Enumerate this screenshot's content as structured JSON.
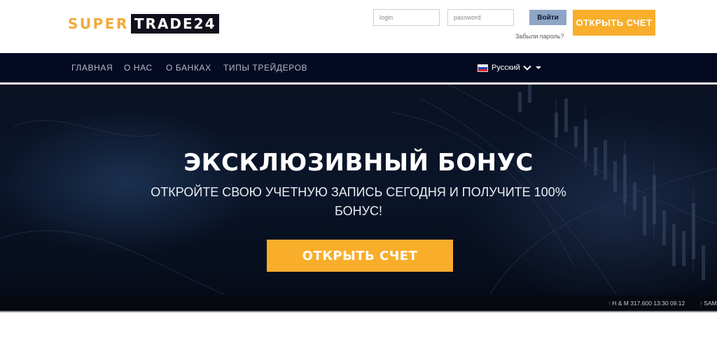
{
  "header": {
    "logo_part1": "SUPER",
    "logo_part2": "TRADE24",
    "login_placeholder": "login",
    "password_placeholder": "password",
    "signin_label": "Войти",
    "forgot_label": "Забыли пароль?",
    "open_account_label": "ОТКРЫТЬ СЧЕТ"
  },
  "nav": {
    "items": [
      {
        "label": "ГЛАВНАЯ"
      },
      {
        "label": "О НАС"
      },
      {
        "label": "О БАНКАХ"
      },
      {
        "label": "ТИПЫ ТРЕЙДЕРОВ"
      }
    ],
    "language": "Русский",
    "flag_icon": "russia-flag-icon"
  },
  "hero": {
    "title": "ЭКСКЛЮЗИВНЫЙ БОНУС",
    "subtitle": "ОТКРОЙТЕ СВОЮ УЧЕТНУЮ ЗАПИСЬ СЕГОДНЯ И ПОЛУЧИТЕ 100% БОНУС!",
    "button_label": "ОТКРЫТЬ СЧЕТ"
  },
  "ticker": {
    "items": [
      {
        "text": "H & M 317.600 13:30 09.12"
      },
      {
        "text": "SAM"
      }
    ]
  },
  "colors": {
    "accent": "#f8ae2b",
    "nav_bg": "#030a22",
    "signin_bg": "#8ea6c5",
    "logo_dark": "#10111d",
    "ticker_up": "#3fbf4a"
  }
}
